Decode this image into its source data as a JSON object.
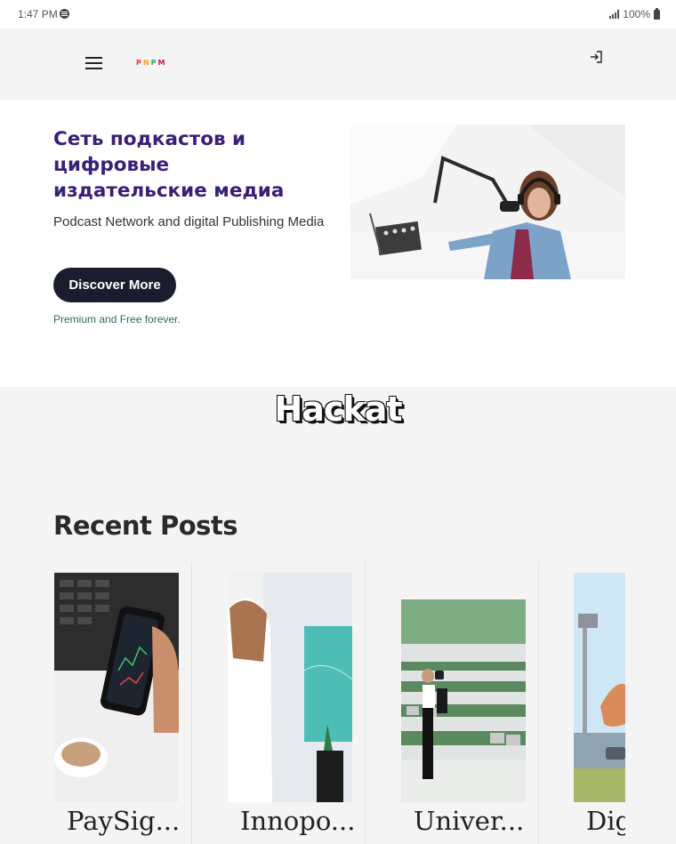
{
  "status_bar": {
    "time": "1:47 PM",
    "battery": "100%"
  },
  "header": {
    "logo_letters": [
      "P",
      "N",
      "P",
      "M"
    ],
    "logo_colors": [
      "#e33b2e",
      "#f1a321",
      "#2fa84f",
      "#c2185b"
    ]
  },
  "hero": {
    "title": "Сеть подкастов и цифровые издательские медиа",
    "subtitle": "Podcast Network and digital Publishing Media",
    "cta_label": "Discover More",
    "note": "Premium and Free forever."
  },
  "brand": {
    "word": "Hackat"
  },
  "recent": {
    "heading": "Recent Posts",
    "posts": [
      {
        "title": "PaySig..."
      },
      {
        "title": "Innopo..."
      },
      {
        "title": "Univer..."
      },
      {
        "title": "Dig"
      }
    ]
  },
  "colors": {
    "accent_dark": "#1b1d2e",
    "title_purple": "#3a1f78",
    "note_green": "#2f6a4d",
    "band_gray": "#f4f4f4"
  }
}
